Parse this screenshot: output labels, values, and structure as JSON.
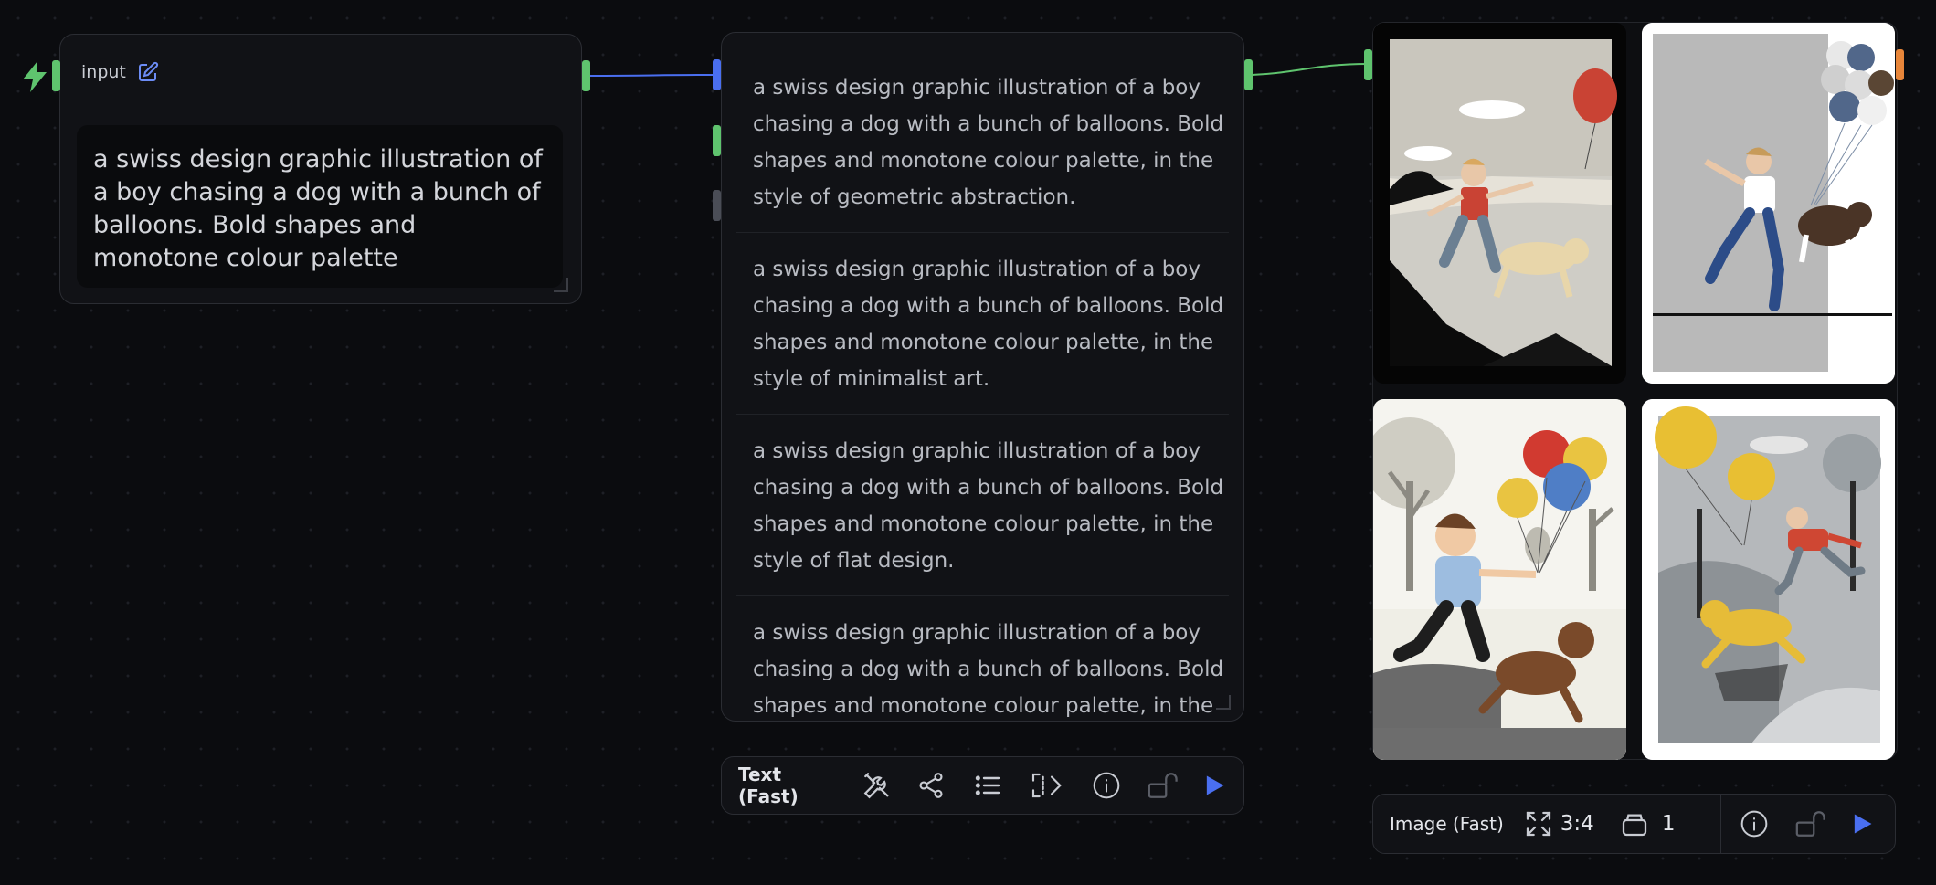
{
  "input_node": {
    "title": "input",
    "prompt": "a swiss design graphic illustration of a boy chasing a dog with a bunch of balloons. Bold shapes and monotone colour palette"
  },
  "text_node": {
    "items": [
      "a swiss design graphic illustration of a boy chasing a dog with a bunch of balloons. Bold shapes and monotone colour palette, in the style of geometric abstraction.",
      "a swiss design graphic illustration of a boy chasing a dog with a bunch of balloons. Bold shapes and monotone colour palette, in the style of minimalist art.",
      "a swiss design graphic illustration of a boy chasing a dog with a bunch of balloons. Bold shapes and monotone colour palette, in the style of flat design.",
      "a swiss design graphic illustration of a boy chasing a dog with a bunch of balloons. Bold shapes and monotone colour palette, in the style of constructivism."
    ]
  },
  "text_toolbar": {
    "model_label": "Text (Fast)",
    "icons": [
      "tools-icon",
      "share-icon",
      "list-icon",
      "expand-code-icon",
      "info-icon",
      "unlock-icon",
      "play-icon"
    ]
  },
  "image_toolbar": {
    "model_label": "Image (Fast)",
    "aspect_ratio": "3:4",
    "count": "1",
    "icons": [
      "expand-icon",
      "layers-icon",
      "info-icon",
      "unlock-icon",
      "play-icon"
    ]
  },
  "colors": {
    "accent_blue": "#4a6ff0",
    "port_green": "#5fc46e",
    "port_orange": "#e8863a",
    "background": "#0b0c0f"
  }
}
